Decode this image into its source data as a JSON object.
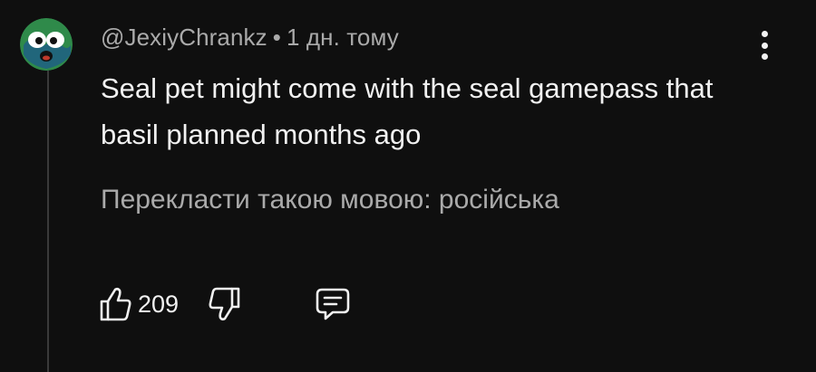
{
  "comment": {
    "author": "@JexiyChrankz",
    "separator": "•",
    "timestamp": "1 дн. тому",
    "text": "Seal pet might come with the seal gamepass that basil planned months ago",
    "translate_label": "Перекласти такою мовою: російська",
    "like_count": "209"
  },
  "icons": {
    "avatar": "avatar-icon",
    "menu": "more-vert-icon",
    "like": "thumbs-up-icon",
    "dislike": "thumbs-down-icon",
    "reply": "reply-comment-icon"
  },
  "colors": {
    "background": "#0f0f0f",
    "text_primary": "#f1f1f1",
    "text_secondary": "#aaaaaa",
    "avatar_green": "#2f8a4a"
  }
}
